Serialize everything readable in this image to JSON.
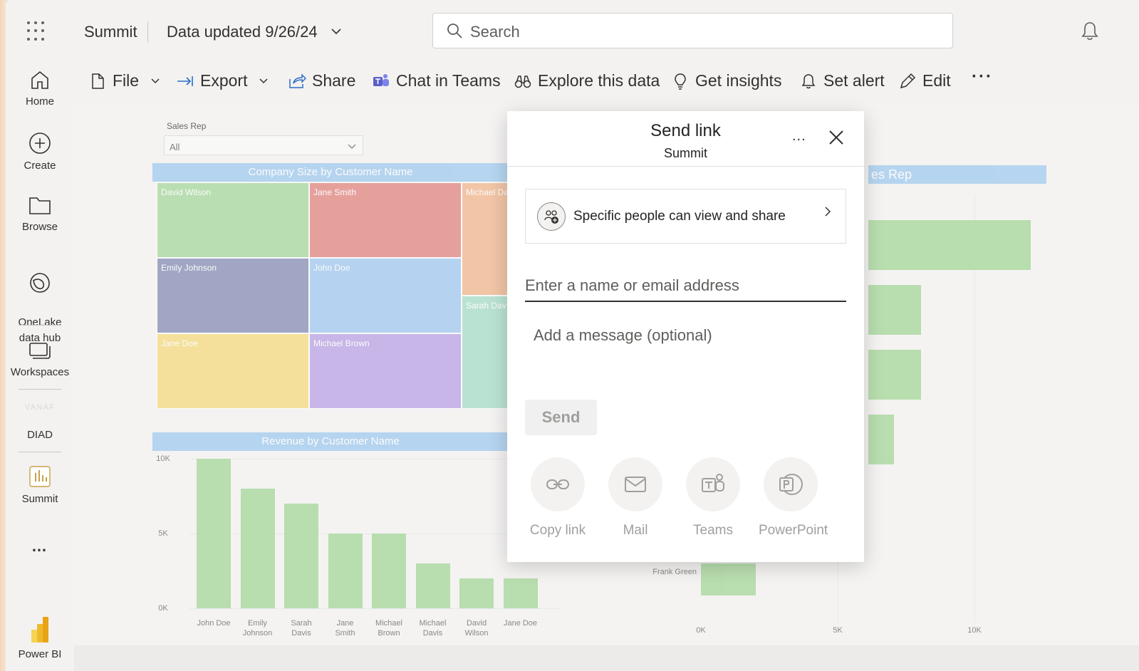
{
  "app": {
    "name": "Summit",
    "updated_label": "Data updated 9/26/24"
  },
  "search": {
    "placeholder": "Search"
  },
  "leftnav": {
    "items": [
      {
        "label": "Home",
        "icon": "home-icon"
      },
      {
        "label": "Create",
        "icon": "plus-circle-icon"
      },
      {
        "label": "Browse",
        "icon": "folder-icon"
      },
      {
        "label": "OneLake\ndata hub",
        "icon": "onelake-icon"
      },
      {
        "label": "Workspaces",
        "icon": "workspaces-icon"
      },
      {
        "label": "DIAD",
        "icon": "diad-logo-icon",
        "logo_text": "VANAF"
      },
      {
        "label": "Summit",
        "icon": "report-icon"
      },
      {
        "label": "…",
        "icon": "more-icon"
      },
      {
        "label": "Power BI",
        "icon": "powerbi-logo-icon"
      }
    ]
  },
  "toolbar": {
    "file": "File",
    "export": "Export",
    "share": "Share",
    "chat": "Chat in Teams",
    "explore": "Explore this data",
    "insights": "Get insights",
    "alert": "Set alert",
    "edit": "Edit"
  },
  "report": {
    "slicer_label": "Sales Rep",
    "slicer_value": "All",
    "treemap": {
      "title": "Company Size by Customer Name",
      "cells": [
        {
          "name": "David Wilson",
          "color": "#a3d69a"
        },
        {
          "name": "Jane Smith",
          "color": "#e2817c"
        },
        {
          "name": "Michael Da",
          "color": "#f0b48a"
        },
        {
          "name": "Emily Johnson",
          "color": "#8089b1"
        },
        {
          "name": "John Doe",
          "color": "#9dc8f0"
        },
        {
          "name": "Sarah Dav",
          "color": "#a5dcc6"
        },
        {
          "name": "Jane Doe",
          "color": "#f4d97a"
        },
        {
          "name": "Michael Brown",
          "color": "#b79fe3"
        }
      ]
    },
    "right_chart_title_fragment": "es Rep",
    "right_chart": {
      "visible_label": "Frank Green",
      "xticks": [
        "0K",
        "5K",
        "10K"
      ]
    }
  },
  "chart_data": [
    {
      "type": "bar",
      "title": "Revenue by Customer Name",
      "categories": [
        "John Doe",
        "Emily Johnson",
        "Sarah Davis",
        "Jane Smith",
        "Michael Brown",
        "Michael Davis",
        "David Wilson",
        "Jane Doe"
      ],
      "values": [
        10000,
        8000,
        7000,
        5000,
        5000,
        3000,
        2000,
        2000
      ],
      "yticks": [
        "0K",
        "5K",
        "10K"
      ],
      "ylim": [
        0,
        10000
      ],
      "color": "#a2d595"
    }
  ],
  "modal": {
    "title": "Send link",
    "subtitle": "Summit",
    "more": "...",
    "permission": "Specific people can view and share",
    "email_placeholder": "Enter a name or email address",
    "message_placeholder": "Add a message (optional)",
    "send": "Send",
    "options": [
      "Copy link",
      "Mail",
      "Teams",
      "PowerPoint"
    ]
  }
}
